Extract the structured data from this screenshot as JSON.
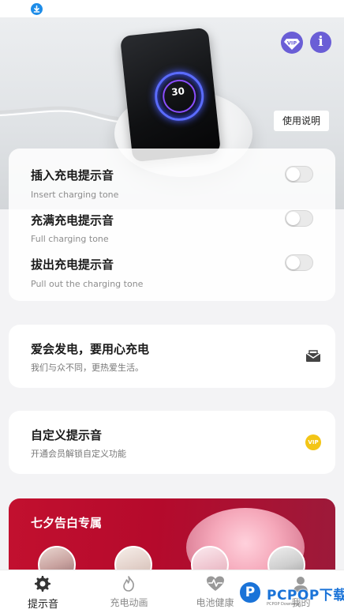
{
  "hero": {
    "ring_value": "30",
    "usage_label": "使用说明",
    "info_label": "i"
  },
  "tones": [
    {
      "title": "插入充电提示音",
      "subtitle": "Insert charging tone",
      "enabled": false
    },
    {
      "title": "充满充电提示音",
      "subtitle": "Full charging tone",
      "enabled": false
    },
    {
      "title": "拔出充电提示音",
      "subtitle": "Pull out the charging tone",
      "enabled": false
    }
  ],
  "love_card": {
    "title": "爱会发电，要用心充电",
    "subtitle": "我们与众不同，更热爱生活。",
    "icon": "envelope-icon"
  },
  "custom_card": {
    "title": "自定义提示音",
    "subtitle": "开通会员解锁自定义功能",
    "badge": "VIP"
  },
  "promo": {
    "title": "七夕告白专属"
  },
  "tabbar": {
    "tabs": [
      {
        "label": "提示音",
        "icon": "gear-icon",
        "active": true
      },
      {
        "label": "充电动画",
        "icon": "flame-icon",
        "active": false
      },
      {
        "label": "电池健康",
        "icon": "heart-pulse-icon",
        "active": false
      },
      {
        "label": "我的",
        "icon": "user-icon",
        "active": false
      }
    ]
  },
  "watermark": {
    "letter": "P",
    "text": "PCPOP下载",
    "small": "PCPOP Download"
  },
  "colors": {
    "accent": "#6a5ed6",
    "promo": "#c2102f",
    "vip": "#f3c516",
    "download": "#1d8ce8"
  }
}
